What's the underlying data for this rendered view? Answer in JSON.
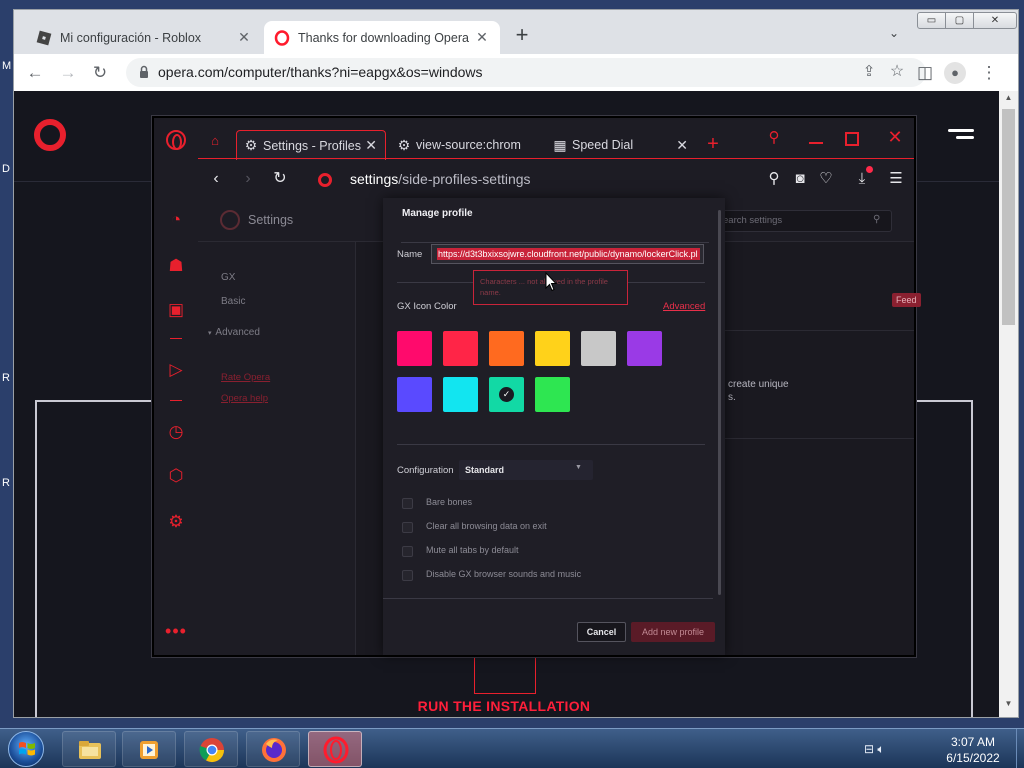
{
  "desktop": {
    "edge_letters": [
      "M",
      "D",
      "R",
      "R"
    ]
  },
  "chrome": {
    "tabs": [
      {
        "title": "Mi configuración - Roblox",
        "icon": "roblox-icon"
      },
      {
        "title": "Thanks for downloading Opera",
        "icon": "opera-icon",
        "active": true
      }
    ],
    "new_tab": "+",
    "url": "opera.com/computer/thanks?ni=eapgx&os=windows",
    "window_controls": {
      "min": "▭",
      "max": "▢",
      "close": "✕"
    }
  },
  "webpage": {
    "run_installation": "RUN THE INSTALLATION"
  },
  "gx": {
    "tabs": [
      {
        "title": "Settings - Profiles",
        "icon": "gear-icon"
      },
      {
        "title": "view-source:chrom",
        "icon": "gear-icon"
      },
      {
        "title": "Speed Dial",
        "icon": "speed-dial-icon"
      }
    ],
    "url_bold": "settings",
    "url_rest": "/side-profiles-settings",
    "settings_title": "Settings",
    "search_placeholder": "earch settings",
    "nav": {
      "gx": "GX",
      "basic": "Basic",
      "advanced": "Advanced",
      "rate": "Rate Opera",
      "help": "Opera help"
    },
    "bg_feed": "Feed",
    "bg_text1": "create unique",
    "bg_text2": "s."
  },
  "dialog": {
    "title": "Manage profile",
    "name_label": "Name",
    "name_value": "https://d3t3bxixsojwre.cloudfront.net/public/dynamo/lockerClick.pl",
    "tooltip": "Characters ... not allowed in the profile name.",
    "color_label": "GX Icon Color",
    "advanced_link": "Advanced",
    "swatch_colors": [
      "#ff0a6c",
      "#ff2547",
      "#ff6a1f",
      "#ffd21a",
      "#c8c8c8",
      "#9a3ae6",
      "#5a4aff",
      "#12e5f0",
      "#12d9a5",
      "#2ee651"
    ],
    "selected_swatch_index": 8,
    "config_label": "Configuration",
    "config_value": "Standard",
    "checkboxes": [
      "Bare bones",
      "Clear all browsing data on exit",
      "Mute all tabs by default",
      "Disable GX browser sounds and music"
    ],
    "cancel": "Cancel",
    "add": "Add new profile"
  },
  "taskbar": {
    "time": "3:07 AM",
    "date": "6/15/2022"
  },
  "colors": {
    "accent": "#e8202d",
    "gx_bg": "#1d1c24"
  }
}
